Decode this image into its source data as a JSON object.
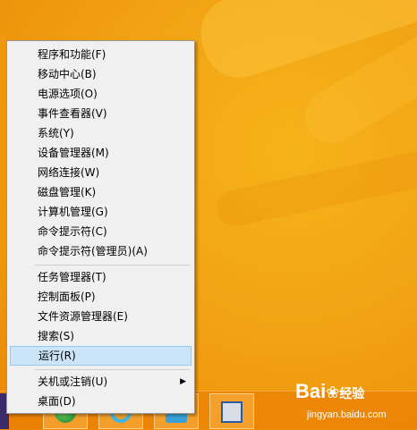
{
  "menu": {
    "items": [
      {
        "label": "程序和功能(F)"
      },
      {
        "label": "移动中心(B)"
      },
      {
        "label": "电源选项(O)"
      },
      {
        "label": "事件查看器(V)"
      },
      {
        "label": "系统(Y)"
      },
      {
        "label": "设备管理器(M)"
      },
      {
        "label": "网络连接(W)"
      },
      {
        "label": "磁盘管理(K)"
      },
      {
        "label": "计算机管理(G)"
      },
      {
        "label": "命令提示符(C)"
      },
      {
        "label": "命令提示符(管理员)(A)"
      },
      {
        "label": "任务管理器(T)"
      },
      {
        "label": "控制面板(P)"
      },
      {
        "label": "文件资源管理器(E)"
      },
      {
        "label": "搜索(S)"
      },
      {
        "label": "运行(R)",
        "selected": true
      },
      {
        "label": "关机或注销(U)",
        "submenu": true
      },
      {
        "label": "桌面(D)"
      }
    ]
  },
  "taskbar": {
    "apps": [
      {
        "icon": "ie-icon"
      },
      {
        "icon": "app-icon"
      },
      {
        "icon": "store-icon"
      },
      {
        "icon": "computer-icon"
      }
    ]
  },
  "watermark": {
    "brand": "Bai",
    "brand2": "经验",
    "url": "jingyan.baidu.com"
  },
  "colors": {
    "desktop": "#f2a313",
    "menu_bg": "#f0f0f0",
    "selected_bg": "#cce4f7",
    "selected_border": "#90c8f6"
  }
}
